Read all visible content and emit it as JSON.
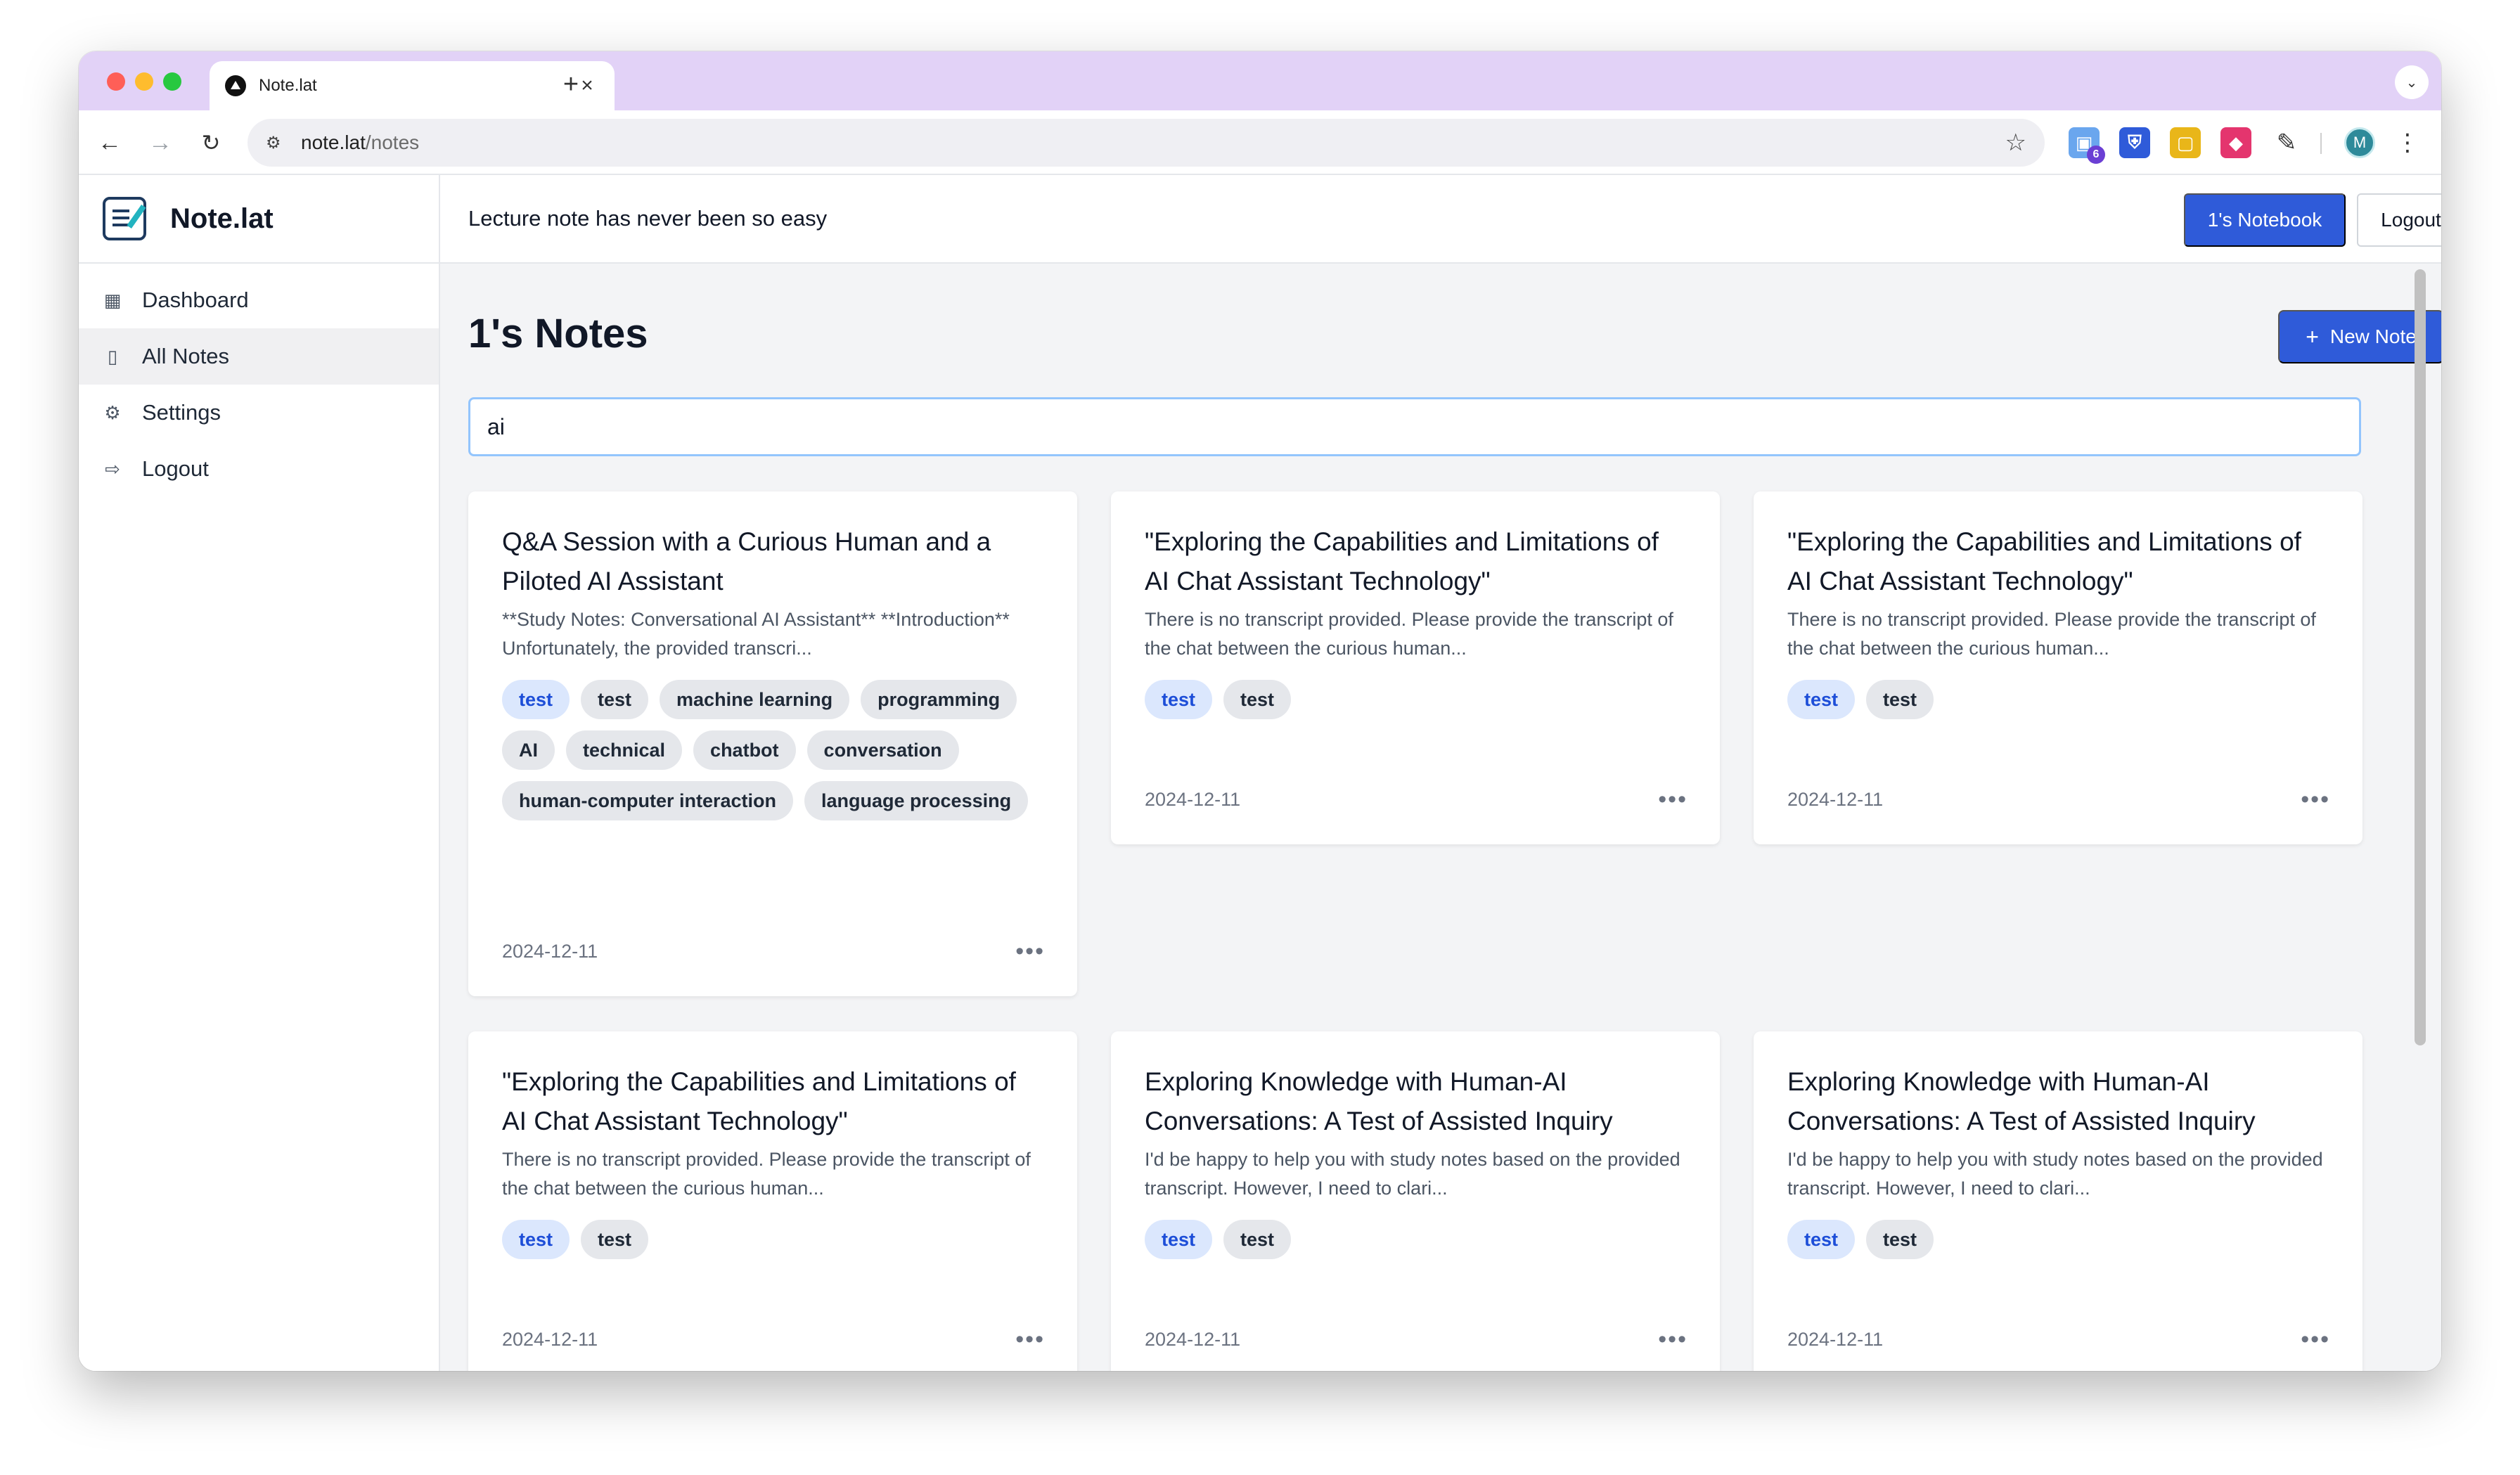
{
  "browser": {
    "tab_title": "Note.lat",
    "tab_close": "×",
    "new_tab": "+",
    "url_host": "note.lat",
    "url_path": "/notes",
    "extension_badge": "6",
    "profile_initial": "M"
  },
  "app": {
    "brand": "Note.lat",
    "tagline": "Lecture note has never been so easy",
    "header": {
      "notebook_button": "1's Notebook",
      "logout_button": "Logout"
    },
    "sidebar": {
      "items": [
        {
          "label": "Dashboard",
          "icon": "grid-icon"
        },
        {
          "label": "All Notes",
          "icon": "book-icon",
          "active": true
        },
        {
          "label": "Settings",
          "icon": "gear-icon"
        },
        {
          "label": "Logout",
          "icon": "logout-icon"
        }
      ]
    },
    "main": {
      "title": "1's Notes",
      "new_note_button": "New Note",
      "search_value": "ai"
    },
    "notes": [
      {
        "title": "Q&A Session with a Curious Human and a Piloted AI Assistant",
        "excerpt": "**Study Notes: Conversational AI Assistant** **Introduction** Unfortunately, the provided transcri...",
        "tags": [
          "test",
          "test",
          "machine learning",
          "programming",
          "AI",
          "technical",
          "chatbot",
          "conversation",
          "human-computer interaction",
          "language processing"
        ],
        "date": "2024-12-11"
      },
      {
        "title": "\"Exploring the Capabilities and Limitations of AI Chat Assistant Technology\"",
        "excerpt": "There is no transcript provided. Please provide the transcript of the chat between the curious human...",
        "tags": [
          "test",
          "test"
        ],
        "date": "2024-12-11"
      },
      {
        "title": "\"Exploring the Capabilities and Limitations of AI Chat Assistant Technology\"",
        "excerpt": "There is no transcript provided. Please provide the transcript of the chat between the curious human...",
        "tags": [
          "test",
          "test"
        ],
        "date": "2024-12-11"
      },
      {
        "title": "\"Exploring the Capabilities and Limitations of AI Chat Assistant Technology\"",
        "excerpt": "There is no transcript provided. Please provide the transcript of the chat between the curious human...",
        "tags": [
          "test",
          "test"
        ],
        "date": "2024-12-11"
      },
      {
        "title": "Exploring Knowledge with Human-AI Conversations: A Test of Assisted Inquiry",
        "excerpt": "I'd be happy to help you with study notes based on the provided transcript. However, I need to clari...",
        "tags": [
          "test",
          "test"
        ],
        "date": "2024-12-11"
      },
      {
        "title": "Exploring Knowledge with Human-AI Conversations: A Test of Assisted Inquiry",
        "excerpt": "I'd be happy to help you with study notes based on the provided transcript. However, I need to clari...",
        "tags": [
          "test",
          "test"
        ],
        "date": "2024-12-11"
      }
    ],
    "colors": {
      "accent": "#2f5bd9",
      "tab_strip": "#e2d2f7",
      "tag_primary_bg": "#dbe7fd",
      "tag_bg": "#e5e7eb"
    }
  }
}
